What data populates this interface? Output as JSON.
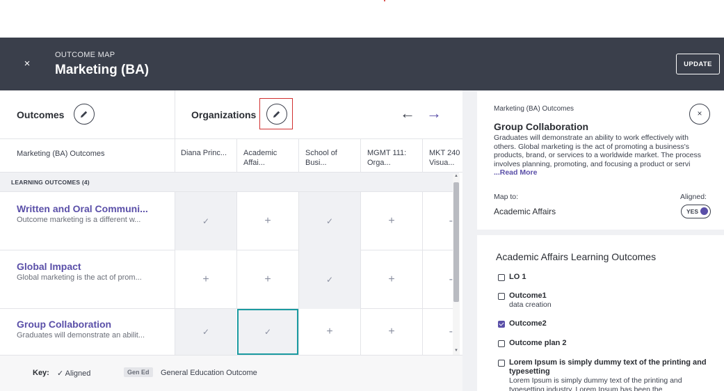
{
  "header": {
    "eyebrow": "OUTCOME MAP",
    "title": "Marketing (BA)",
    "close_icon": "×",
    "update_label": "UPDATE"
  },
  "grid": {
    "outcomes_heading": "Outcomes",
    "organizations_heading": "Organizations",
    "prev_arrow": "←",
    "next_arrow": "→",
    "columns": [
      "Marketing (BA) Outcomes",
      "Diana Princ...",
      "Academic\nAffai...",
      "School of\nBusi...",
      "MGMT 111:\nOrga...",
      "MKT 240\nVisua..."
    ],
    "section_label": "LEARNING OUTCOMES (4)",
    "rows": [
      {
        "title": "Written and Oral Communi...",
        "desc": "Outcome marketing is a different w...",
        "cells": [
          "✓",
          "+",
          "✓",
          "+",
          "-"
        ]
      },
      {
        "title": "Global Impact",
        "desc": "Global marketing is the act of prom...",
        "cells": [
          "+",
          "+",
          "✓",
          "+",
          "-"
        ]
      },
      {
        "title": "Group Collaboration",
        "desc": "Graduates will demonstrate an abilit...",
        "cells": [
          "✓",
          "✓",
          "+",
          "+",
          "-"
        ]
      }
    ]
  },
  "key": {
    "label": "Key:",
    "aligned": "✓ Aligned",
    "gen_badge": "Gen Ed",
    "gen_text": "General Education Outcome"
  },
  "detail": {
    "eyebrow": "Marketing (BA) Outcomes",
    "close_icon": "×",
    "title": "Group Collaboration",
    "body": "Graduates will demonstrate an ability to work effectively with others. Global marketing is the act of promoting a business's products, brand, or services to a worldwide market. The process involves planning, promoting, and focusing a product or servi ",
    "read_more": "...Read More",
    "map_to_label": "Map to:",
    "aligned_label": "Aligned:",
    "org_name": "Academic Affairs",
    "toggle_label": "YES"
  },
  "org_outcomes": {
    "title": "Academic Affairs Learning Outcomes",
    "items": [
      {
        "title": "LO 1",
        "desc": "",
        "checked": false
      },
      {
        "title": "Outcome1",
        "desc": "data creation",
        "checked": false
      },
      {
        "title": "Outcome2",
        "desc": "",
        "checked": true
      },
      {
        "title": "Outcome plan 2",
        "desc": "",
        "checked": false
      },
      {
        "title": "Lorem Ipsum is simply dummy text of the printing and typesetting",
        "desc": "Lorem Ipsum is simply dummy text of the printing and typesetting industry. Lorem Ipsum has been the",
        "checked": false
      }
    ]
  }
}
